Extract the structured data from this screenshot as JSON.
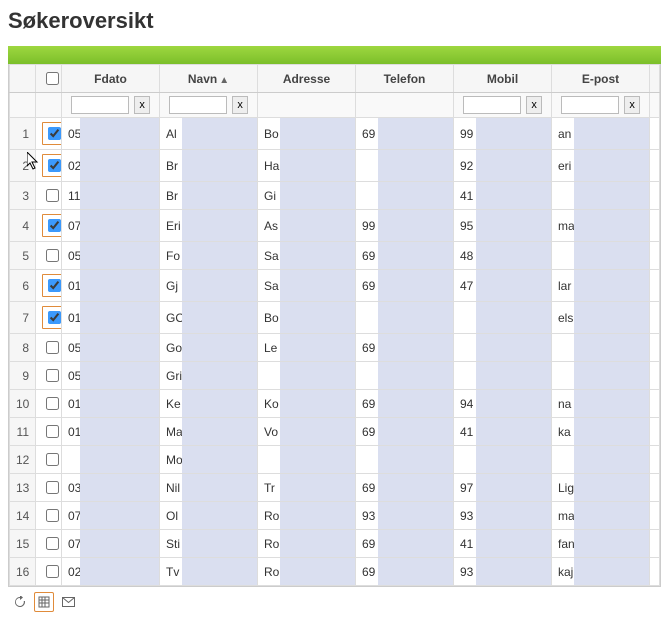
{
  "page": {
    "title": "Søkeroversikt"
  },
  "columns": {
    "fdato": {
      "label": "Fdato"
    },
    "navn": {
      "label": "Navn",
      "sort_indicator": "▲"
    },
    "adresse": {
      "label": "Adresse"
    },
    "telefon": {
      "label": "Telefon"
    },
    "mobil": {
      "label": "Mobil"
    },
    "epost": {
      "label": "E-post"
    }
  },
  "filters": {
    "clear_label": "x",
    "fdato": {
      "value": ""
    },
    "navn": {
      "value": ""
    },
    "mobil": {
      "value": ""
    },
    "epost": {
      "value": ""
    }
  },
  "rows": [
    {
      "n": "1",
      "checked": true,
      "hl": true,
      "fdato": "05",
      "navn": "Al",
      "adr": "Bo",
      "tlf": "69",
      "mob": "99",
      "epost": "an"
    },
    {
      "n": "2",
      "checked": true,
      "hl": true,
      "fdato": "02",
      "navn": "Br",
      "adr": "Ha",
      "tlf": "",
      "mob": "92",
      "epost": "eri"
    },
    {
      "n": "3",
      "checked": false,
      "hl": false,
      "fdato": "11",
      "navn": "Br",
      "adr": "Gi",
      "tlf": "",
      "mob": "41",
      "epost": ""
    },
    {
      "n": "4",
      "checked": true,
      "hl": true,
      "fdato": "07",
      "navn": "Eri",
      "adr": "As",
      "tlf": "99",
      "mob": "95",
      "epost": "ma"
    },
    {
      "n": "5",
      "checked": false,
      "hl": false,
      "fdato": "05",
      "navn": "Fo",
      "adr": "Sa",
      "tlf": "69",
      "mob": "48",
      "epost": ""
    },
    {
      "n": "6",
      "checked": true,
      "hl": true,
      "fdato": "01",
      "navn": "Gj",
      "adr": "Sa",
      "tlf": "69",
      "mob": "47",
      "epost": "lar"
    },
    {
      "n": "7",
      "checked": true,
      "hl": true,
      "fdato": "01",
      "navn": "GO",
      "adr": "Bo",
      "tlf": "",
      "mob": "",
      "epost": "els"
    },
    {
      "n": "8",
      "checked": false,
      "hl": false,
      "fdato": "05",
      "navn": "Go",
      "adr": "Le",
      "tlf": "69",
      "mob": "",
      "epost": ""
    },
    {
      "n": "9",
      "checked": false,
      "hl": false,
      "fdato": "05",
      "navn": "Gri",
      "adr": "",
      "tlf": "",
      "mob": "",
      "epost": ""
    },
    {
      "n": "10",
      "checked": false,
      "hl": false,
      "fdato": "01",
      "navn": "Ke",
      "adr": "Ko",
      "tlf": "69",
      "mob": "94",
      "epost": "na"
    },
    {
      "n": "11",
      "checked": false,
      "hl": false,
      "fdato": "01",
      "navn": "Ma",
      "adr": "Vo",
      "tlf": "69",
      "mob": "41",
      "epost": "ka"
    },
    {
      "n": "12",
      "checked": false,
      "hl": false,
      "fdato": "",
      "navn": "Mo",
      "adr": "",
      "tlf": "",
      "mob": "",
      "epost": ""
    },
    {
      "n": "13",
      "checked": false,
      "hl": false,
      "fdato": "03",
      "navn": "Nil",
      "adr": "Tr",
      "tlf": "69",
      "mob": "97",
      "epost": "Lig"
    },
    {
      "n": "14",
      "checked": false,
      "hl": false,
      "fdato": "07",
      "navn": "Ol",
      "adr": "Ro",
      "tlf": "93",
      "mob": "93",
      "epost": "ma"
    },
    {
      "n": "15",
      "checked": false,
      "hl": false,
      "fdato": "07",
      "navn": "Sti",
      "adr": "Ro",
      "tlf": "69",
      "mob": "41",
      "epost": "fan"
    },
    {
      "n": "16",
      "checked": false,
      "hl": false,
      "fdato": "02",
      "navn": "Tv",
      "adr": "Ro",
      "tlf": "69",
      "mob": "93",
      "epost": "kaj"
    }
  ],
  "toolbar": {
    "refresh_icon": "refresh-icon",
    "grid_icon": "grid-icon",
    "mail_icon": "mail-icon"
  }
}
